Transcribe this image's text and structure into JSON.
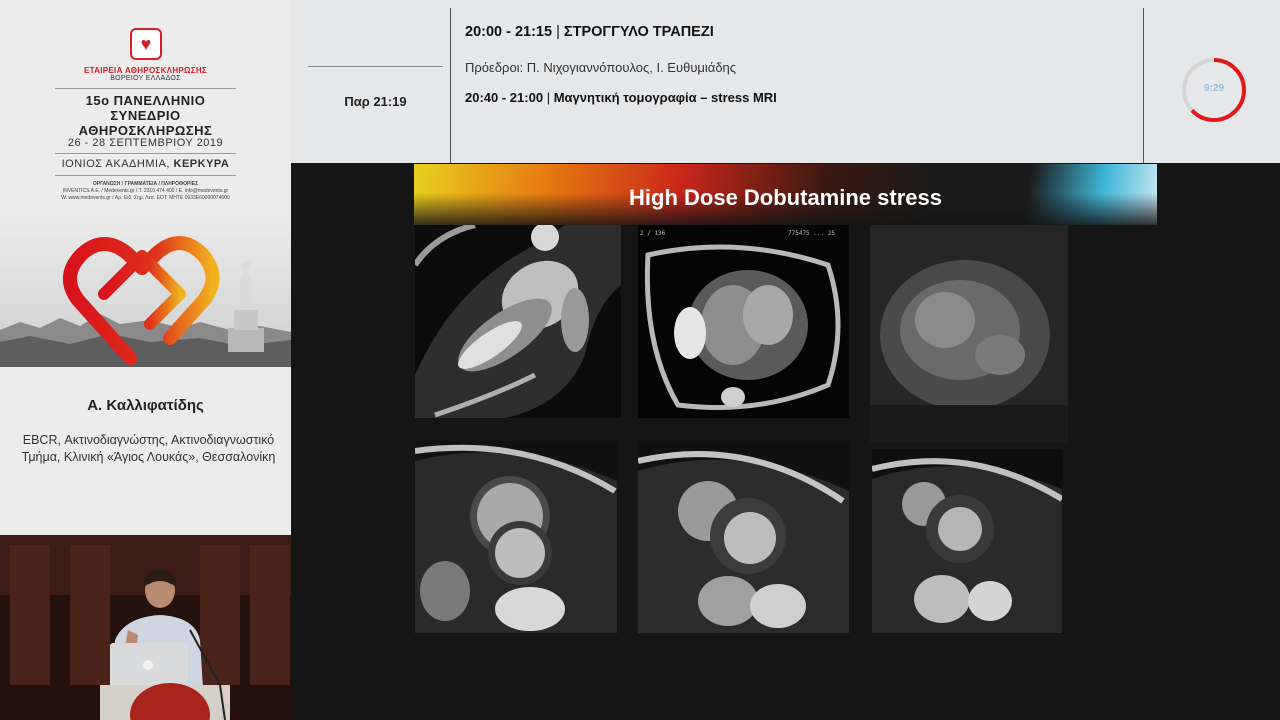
{
  "branding": {
    "society_line1": "ΕΤΑΙΡΕΙΑ ΑΘΗΡΟΣΚΛΗΡΩΣΗΣ",
    "society_line2": "ΒΟΡΕΙΟΥ ΕΛΛΑΔΟΣ",
    "congress_line1": "15ο ΠΑΝΕΛΛΗΝΙΟ",
    "congress_line2": "ΣΥΝΕΔΡΙΟ",
    "congress_line3": "ΑΘΗΡΟΣΚΛΗΡΩΣΗΣ",
    "dates": "26 - 28 ΣΕΠΤΕΜΒΡΙΟΥ 2019",
    "venue_prefix": "ΙΟΝΙΟΣ ΑΚΑΔΗΜΙΑ,",
    "venue_city": "ΚΕΡΚΥΡΑ",
    "organizer_line1": "ΟΡΓΑΝΩΣΗ / ΓΡΑΜΜΑΤΕΙΑ / ΠΛΗΡΟΦΟΡΙΕΣ",
    "organizer_line2": "INVENTICS A.E. / Medevents.gr / T. 2310 474 400 / E. info@medevents.gr",
    "organizer_line3": "W. www.medevents.gr / Αρ. Ειδ. Σημ. Λειτ. ΕΟΤ: MHTE 0933E60000074600",
    "colors": {
      "brand_red": "#d32027"
    }
  },
  "speaker": {
    "name": "Α. Καλλιφατίδης",
    "affiliation_line1": "EBCR, Ακτινοδιαγνώστης, Ακτινοδιαγνωστικό",
    "affiliation_line2": "Τμήμα, Κλινική «Άγιος Λουκάς», Θεσσαλονίκη"
  },
  "header": {
    "clock": "Παρ 21:19",
    "session_time": "20:00 - 21:15",
    "session_sep": "|",
    "session_name": "ΣΤΡΟΓΓΥΛΟ ΤΡΑΠΕΖΙ",
    "chairs": "Πρόεδροι: Π. Νιχογιαννόπουλος, Ι. Ευθυμιάδης",
    "talk_time": "20:40 - 21:00",
    "talk_name": "Μαγνητική τομογραφία – stress MRI",
    "timer_value": "9:29",
    "timer_fraction": 0.63,
    "colors": {
      "timer_ring": "#e01a1a",
      "timer_track": "#d4d4d4"
    }
  },
  "slide": {
    "title": "High Dose Dobutamine stress",
    "images": [
      {
        "name": "mri-long-axis-2ch"
      },
      {
        "name": "mri-four-chamber"
      },
      {
        "name": "mri-blurred-frame"
      },
      {
        "name": "mri-short-axis-base"
      },
      {
        "name": "mri-short-axis-mid"
      },
      {
        "name": "mri-short-axis-apex"
      }
    ]
  }
}
